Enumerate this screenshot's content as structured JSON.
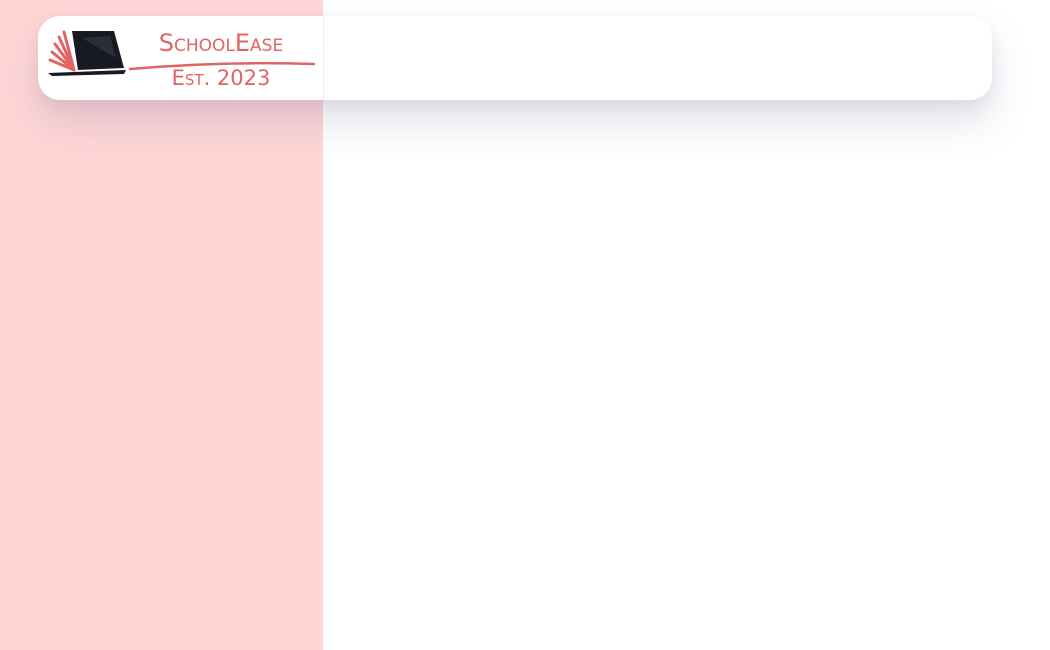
{
  "brand": {
    "name": "SchoolEase",
    "tagline": "Est. 2023",
    "colors": {
      "accent": "#e06464",
      "mark_dark": "#171a21",
      "sidebar_bg": "#ffd6d6",
      "page_bg": "#ffffff"
    },
    "logo_icon": "open-book-laptop-icon"
  }
}
